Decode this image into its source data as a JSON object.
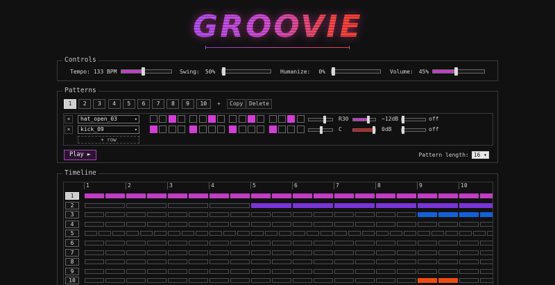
{
  "app": {
    "title": "GROOVIE"
  },
  "colors": {
    "accent": "#c13ec4",
    "step_on": "#d23ed4",
    "purple": "#7a35d8",
    "blue": "#1460d8",
    "orange": "#ee4b10",
    "red": "#cc1c1c"
  },
  "controls": {
    "legend": "Controls",
    "tempo": {
      "label": "Tempo: 133 BPM",
      "level": 0.42
    },
    "swing": {
      "label": "Swing:",
      "value": "50%",
      "level": 0.0
    },
    "humanize": {
      "label": "Humanize:",
      "value": "0%",
      "level": 0.0
    },
    "volume": {
      "label": "Volume:",
      "value": "45%",
      "level": 0.45
    }
  },
  "patterns": {
    "legend": "Patterns",
    "tabs": [
      "1",
      "2",
      "3",
      "4",
      "5",
      "6",
      "7",
      "8",
      "9",
      "10"
    ],
    "selected_tab": "1",
    "add_label": "+",
    "copy_label": "Copy",
    "delete_label": "Delete",
    "rows": [
      {
        "remove": "×",
        "instrument": "hat_open_03",
        "steps": [
          0,
          0,
          1,
          0,
          0,
          0,
          1,
          0,
          0,
          0,
          1,
          0,
          0,
          0,
          1,
          0
        ],
        "pan_label": "R30",
        "pan_level": 0.65,
        "gain_label": "−12dB",
        "gain_level": 0.65,
        "gain_color": "#c13ec4",
        "fx_label": "off",
        "fx_level": 0.0
      },
      {
        "remove": "×",
        "instrument": "kick_09",
        "steps": [
          1,
          0,
          0,
          0,
          1,
          0,
          0,
          0,
          1,
          0,
          0,
          0,
          1,
          0,
          0,
          0
        ],
        "pan_label": "C",
        "pan_level": 0.5,
        "gain_label": "0dB",
        "gain_level": 0.98,
        "gain_color": "#cc1c1c",
        "fx_label": "off",
        "fx_level": 0.0
      }
    ],
    "add_row_label": "+ row",
    "play_label": "Play ►",
    "pattern_length_label": "Pattern length:",
    "pattern_length_value": "16"
  },
  "timeline": {
    "legend": "Timeline",
    "bars": [
      "1",
      "2",
      "3",
      "4",
      "5",
      "6",
      "7",
      "8",
      "9",
      "10"
    ],
    "tracks": [
      {
        "label": "1",
        "selected": true,
        "subdiv": 2,
        "fills": [
          {
            "from": 1,
            "to": 10,
            "color": "#c13ec4"
          }
        ]
      },
      {
        "label": "2",
        "selected": false,
        "subdiv": 1,
        "fills": [
          {
            "from": 5,
            "to": 10,
            "color": "#7a35d8"
          }
        ]
      },
      {
        "label": "3",
        "selected": false,
        "subdiv": 2,
        "fills": [
          {
            "from": 9,
            "to": 10,
            "color": "#1460d8"
          }
        ]
      },
      {
        "label": "4",
        "selected": false,
        "subdiv": 2,
        "fills": []
      },
      {
        "label": "5",
        "selected": false,
        "subdiv": 3,
        "fills": []
      },
      {
        "label": "6",
        "selected": false,
        "subdiv": 2,
        "fills": []
      },
      {
        "label": "7",
        "selected": false,
        "subdiv": 2,
        "fills": []
      },
      {
        "label": "8",
        "selected": false,
        "subdiv": 2,
        "fills": []
      },
      {
        "label": "9",
        "selected": false,
        "subdiv": 2,
        "fills": []
      },
      {
        "label": "10",
        "selected": false,
        "subdiv": 2,
        "fills": [
          {
            "from": 9,
            "to": 9,
            "color": "#ee4b10"
          }
        ]
      }
    ]
  }
}
